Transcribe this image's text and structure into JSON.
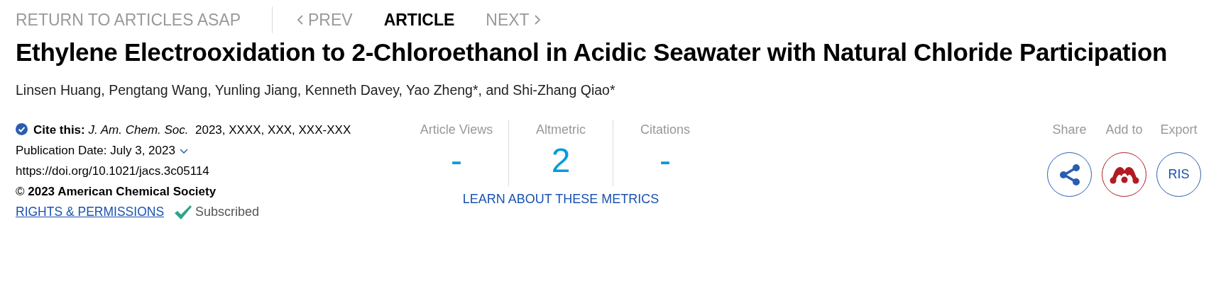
{
  "nav": [
    {
      "kind": "link",
      "label": "RETURN TO ARTICLES ASAP",
      "selected": false
    },
    {
      "kind": "prev",
      "label": "PREV",
      "selected": false
    },
    {
      "kind": "current",
      "label": "ARTICLE",
      "selected": true
    },
    {
      "kind": "next",
      "label": "NEXT",
      "selected": false
    }
  ],
  "title": "Ethylene Electrooxidation to 2-Chloroethanol in Acidic Seawater with Natural Chloride Participation",
  "authors": "Linsen Huang, Pengtang Wang, Yunling Jiang, Kenneth Davey, Yao Zheng*, and Shi-Zhang Qiao*",
  "citation": {
    "cite": "**Cite this:** *J. Am. Chem. Soc.*  2023, XXXX, XXX, XXX-XXX",
    "publication_date": "Publication Date: July 3, 2023",
    "doi": "https://doi.org/10.1021/jacs.3c05114",
    "copyright": "© **2023 American Chemical Society**",
    "rights_link": "RIGHTS & PERMISSIONS",
    "subscribed": "Subscribed"
  },
  "metrics": [
    {
      "label": "Article Views",
      "value": "-"
    },
    {
      "label": "Altmetric",
      "value": "2"
    },
    {
      "label": "Citations",
      "value": "-"
    }
  ],
  "learn_link": "LEARN ABOUT THESE METRICS",
  "actions": [
    {
      "kind": "share",
      "label": "Share"
    },
    {
      "kind": "mendeley",
      "label": "Add to"
    },
    {
      "kind": "ris",
      "label": "Export",
      "button": "RIS"
    }
  ]
}
